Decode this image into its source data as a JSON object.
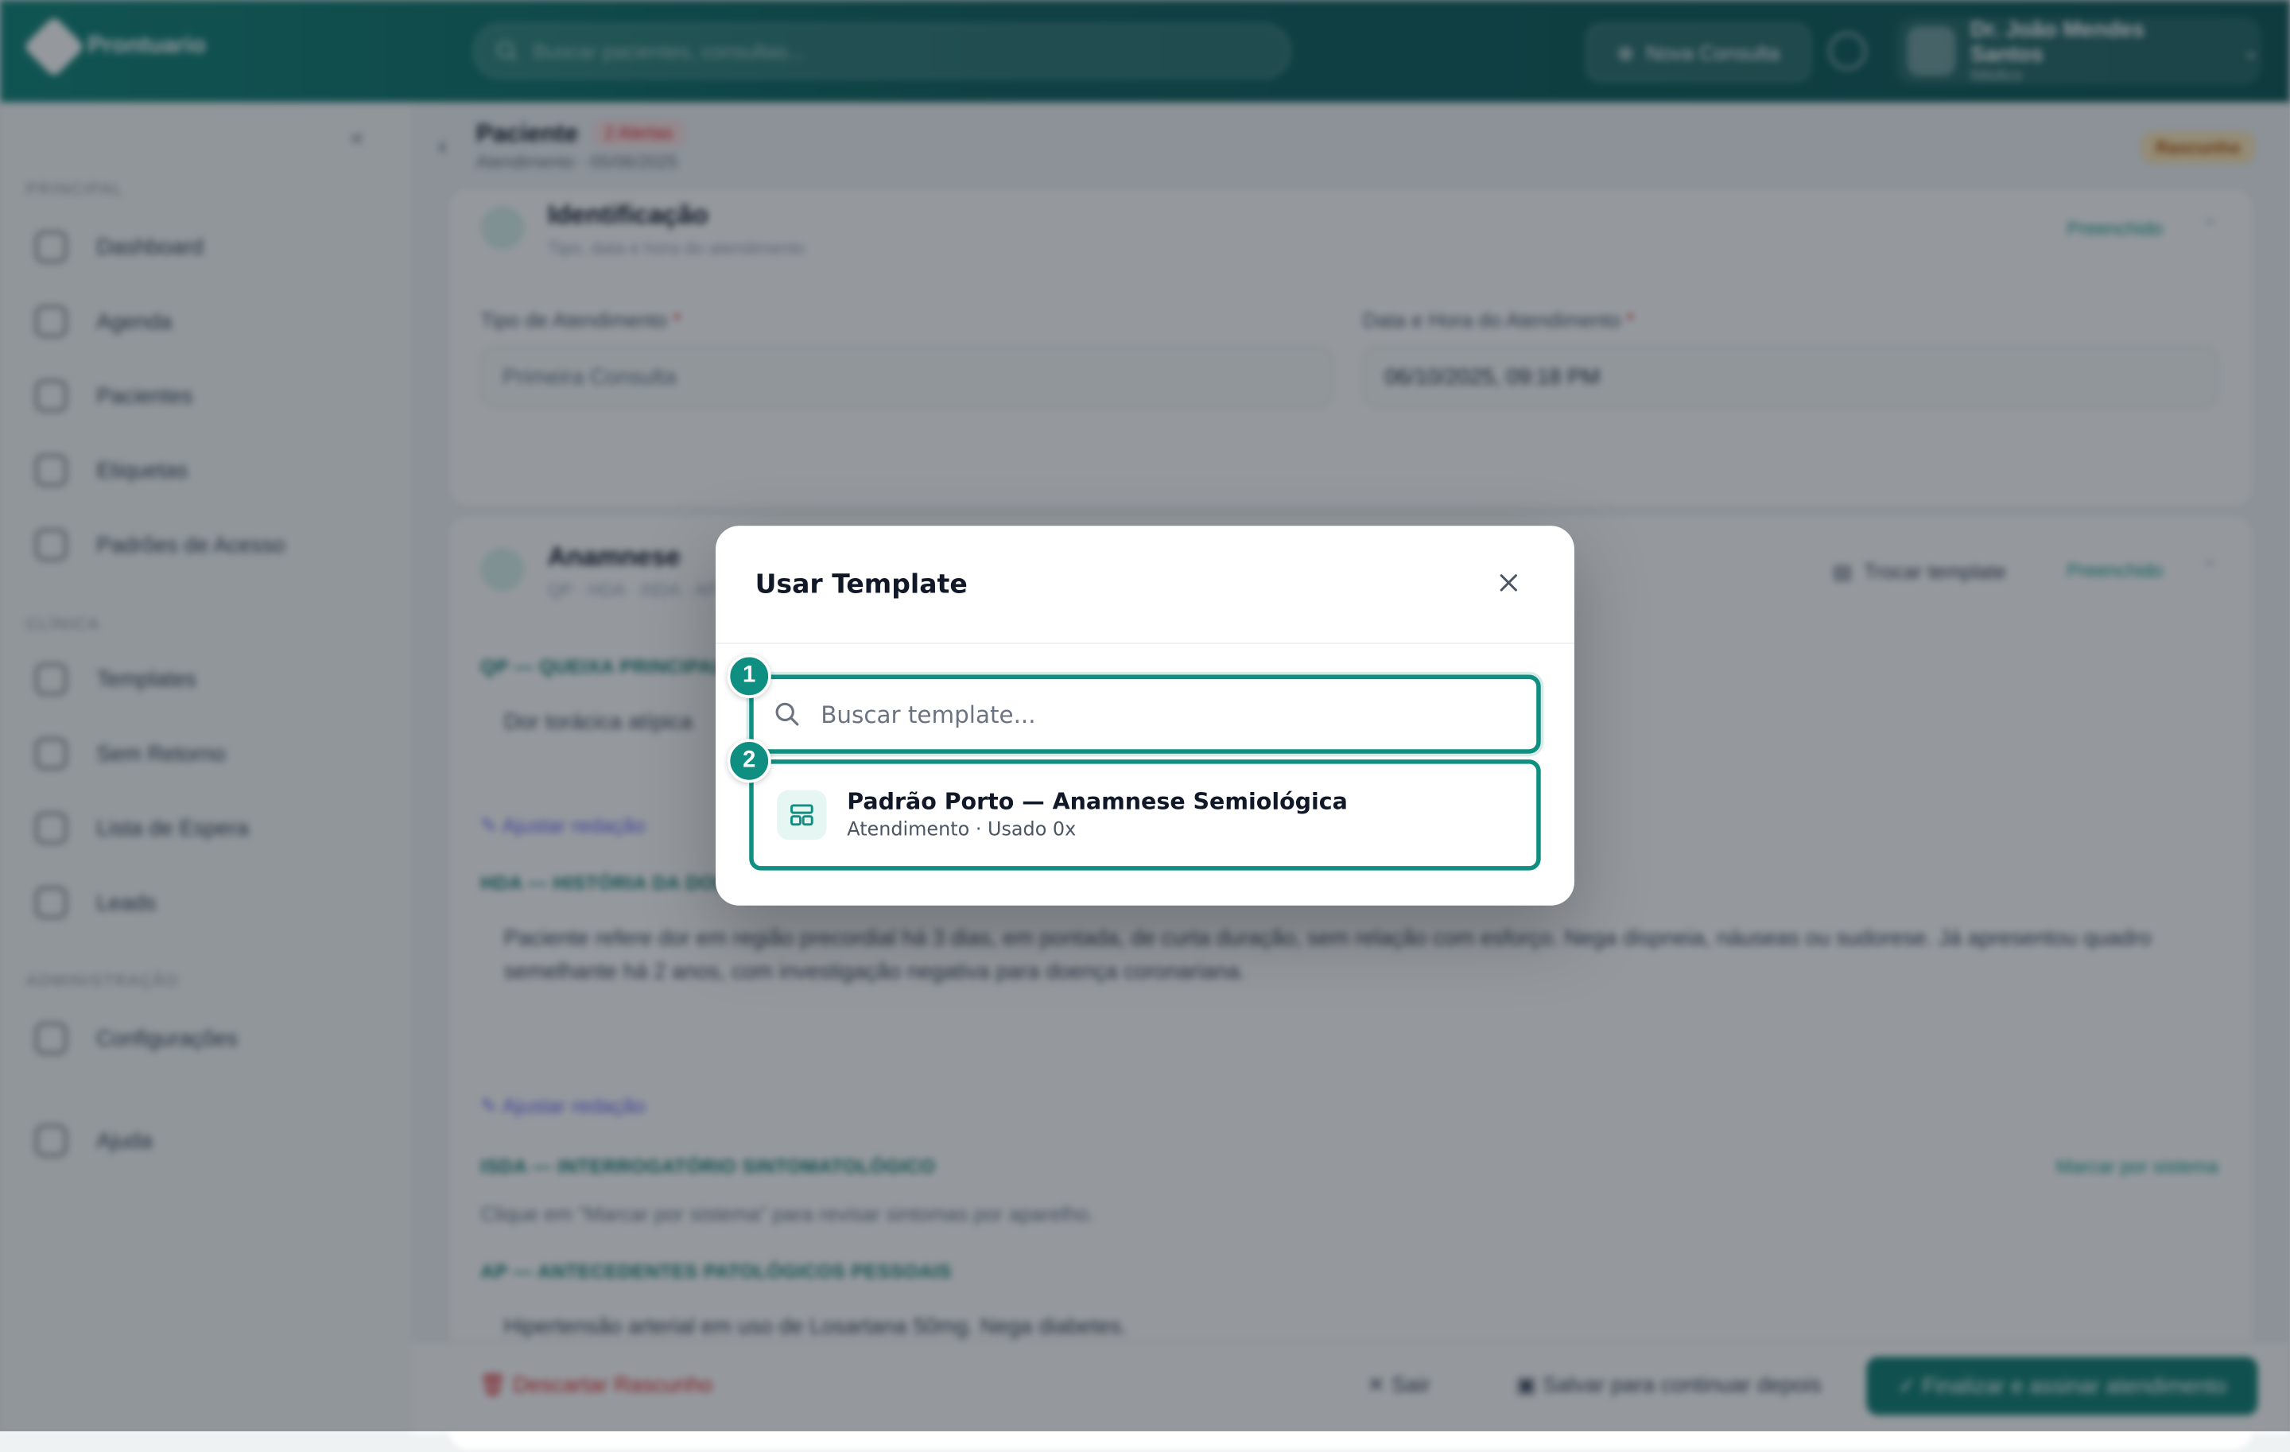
{
  "topbar": {
    "brand": "Prontuario",
    "search_placeholder": "Buscar pacientes, consultas...",
    "new_consult_label": "Nova Consulta",
    "user_name": "Dr. João Mendes Santos",
    "user_role": "Médico"
  },
  "sidebar": {
    "section_main": "PRINCIPAL",
    "section_clinic": "CLÍNICA",
    "section_admin": "ADMINISTRAÇÃO",
    "items_main": [
      {
        "label": "Dashboard"
      },
      {
        "label": "Agenda"
      },
      {
        "label": "Pacientes"
      },
      {
        "label": "Etiquetas"
      },
      {
        "label": "Padrões de Acesso"
      }
    ],
    "items_clinic": [
      {
        "label": "Templates"
      },
      {
        "label": "Sem Retorno"
      },
      {
        "label": "Lista de Espera"
      },
      {
        "label": "Leads"
      }
    ],
    "items_admin": [
      {
        "label": "Configurações"
      }
    ],
    "help_label": "Ajuda"
  },
  "header": {
    "title": "Paciente",
    "badge": "2 Alertas",
    "subtitle": "Atendimento · 05/06/2025",
    "status": "Rascunho"
  },
  "identificacao": {
    "title": "Identificação",
    "subtitle": "Tipo, data e hora do atendimento",
    "filled": "Preenchido",
    "tipo_label": "Tipo de Atendimento",
    "tipo_value": "Primeira Consulta",
    "data_label": "Data e Hora do Atendimento",
    "data_value": "06/10/2025, 09:18 PM"
  },
  "anamnese": {
    "title": "Anamnese",
    "subtitle": "QP · HDA · ISDA · AP",
    "swap_template": "Trocar template",
    "filled": "Preenchido",
    "qp_label": "QP — QUEIXA PRINCIPAL",
    "qp_text": "Dor torácica atípica",
    "variation_link": "Ajustar redação",
    "hda_label": "HDA — HISTÓRIA DA DOENÇA ATUAL",
    "hda_text": "Paciente refere dor em região precordial há 3 dias, em pontada, de curta duração, sem relação com esforço. Nega dispneia, náuseas ou sudorese. Já apresentou quadro semelhante há 2 anos, com investigação negativa para doença coronariana.",
    "isda_label": "ISDA — INTERROGATÓRIO SINTOMATOLÓGICO",
    "isda_link": "Marcar por sistema",
    "isda_hint": "Clique em “Marcar por sistema” para revisar sintomas por aparelho.",
    "ap_label": "AP — ANTECEDENTES PATOLÓGICOS PESSOAIS",
    "ap_text": "Hipertensão arterial em uso de Losartana 50mg. Nega diabetes."
  },
  "footer": {
    "delete_label": "Descartar Rascunho",
    "exit_label": "Sair",
    "save_label": "Salvar para continuar depois",
    "finish_label": "Finalizar e assinar atendimento"
  },
  "modal": {
    "title": "Usar Template",
    "search_placeholder": "Buscar template...",
    "templates": [
      {
        "name": "Padrão Porto — Anamnese Semiológica",
        "meta": "Atendimento · Usado 0x"
      }
    ],
    "markers": [
      "1",
      "2"
    ]
  },
  "colors": {
    "accent": "#0f8f82",
    "topbar": "#0b5e5a",
    "danger": "#dc2626"
  }
}
